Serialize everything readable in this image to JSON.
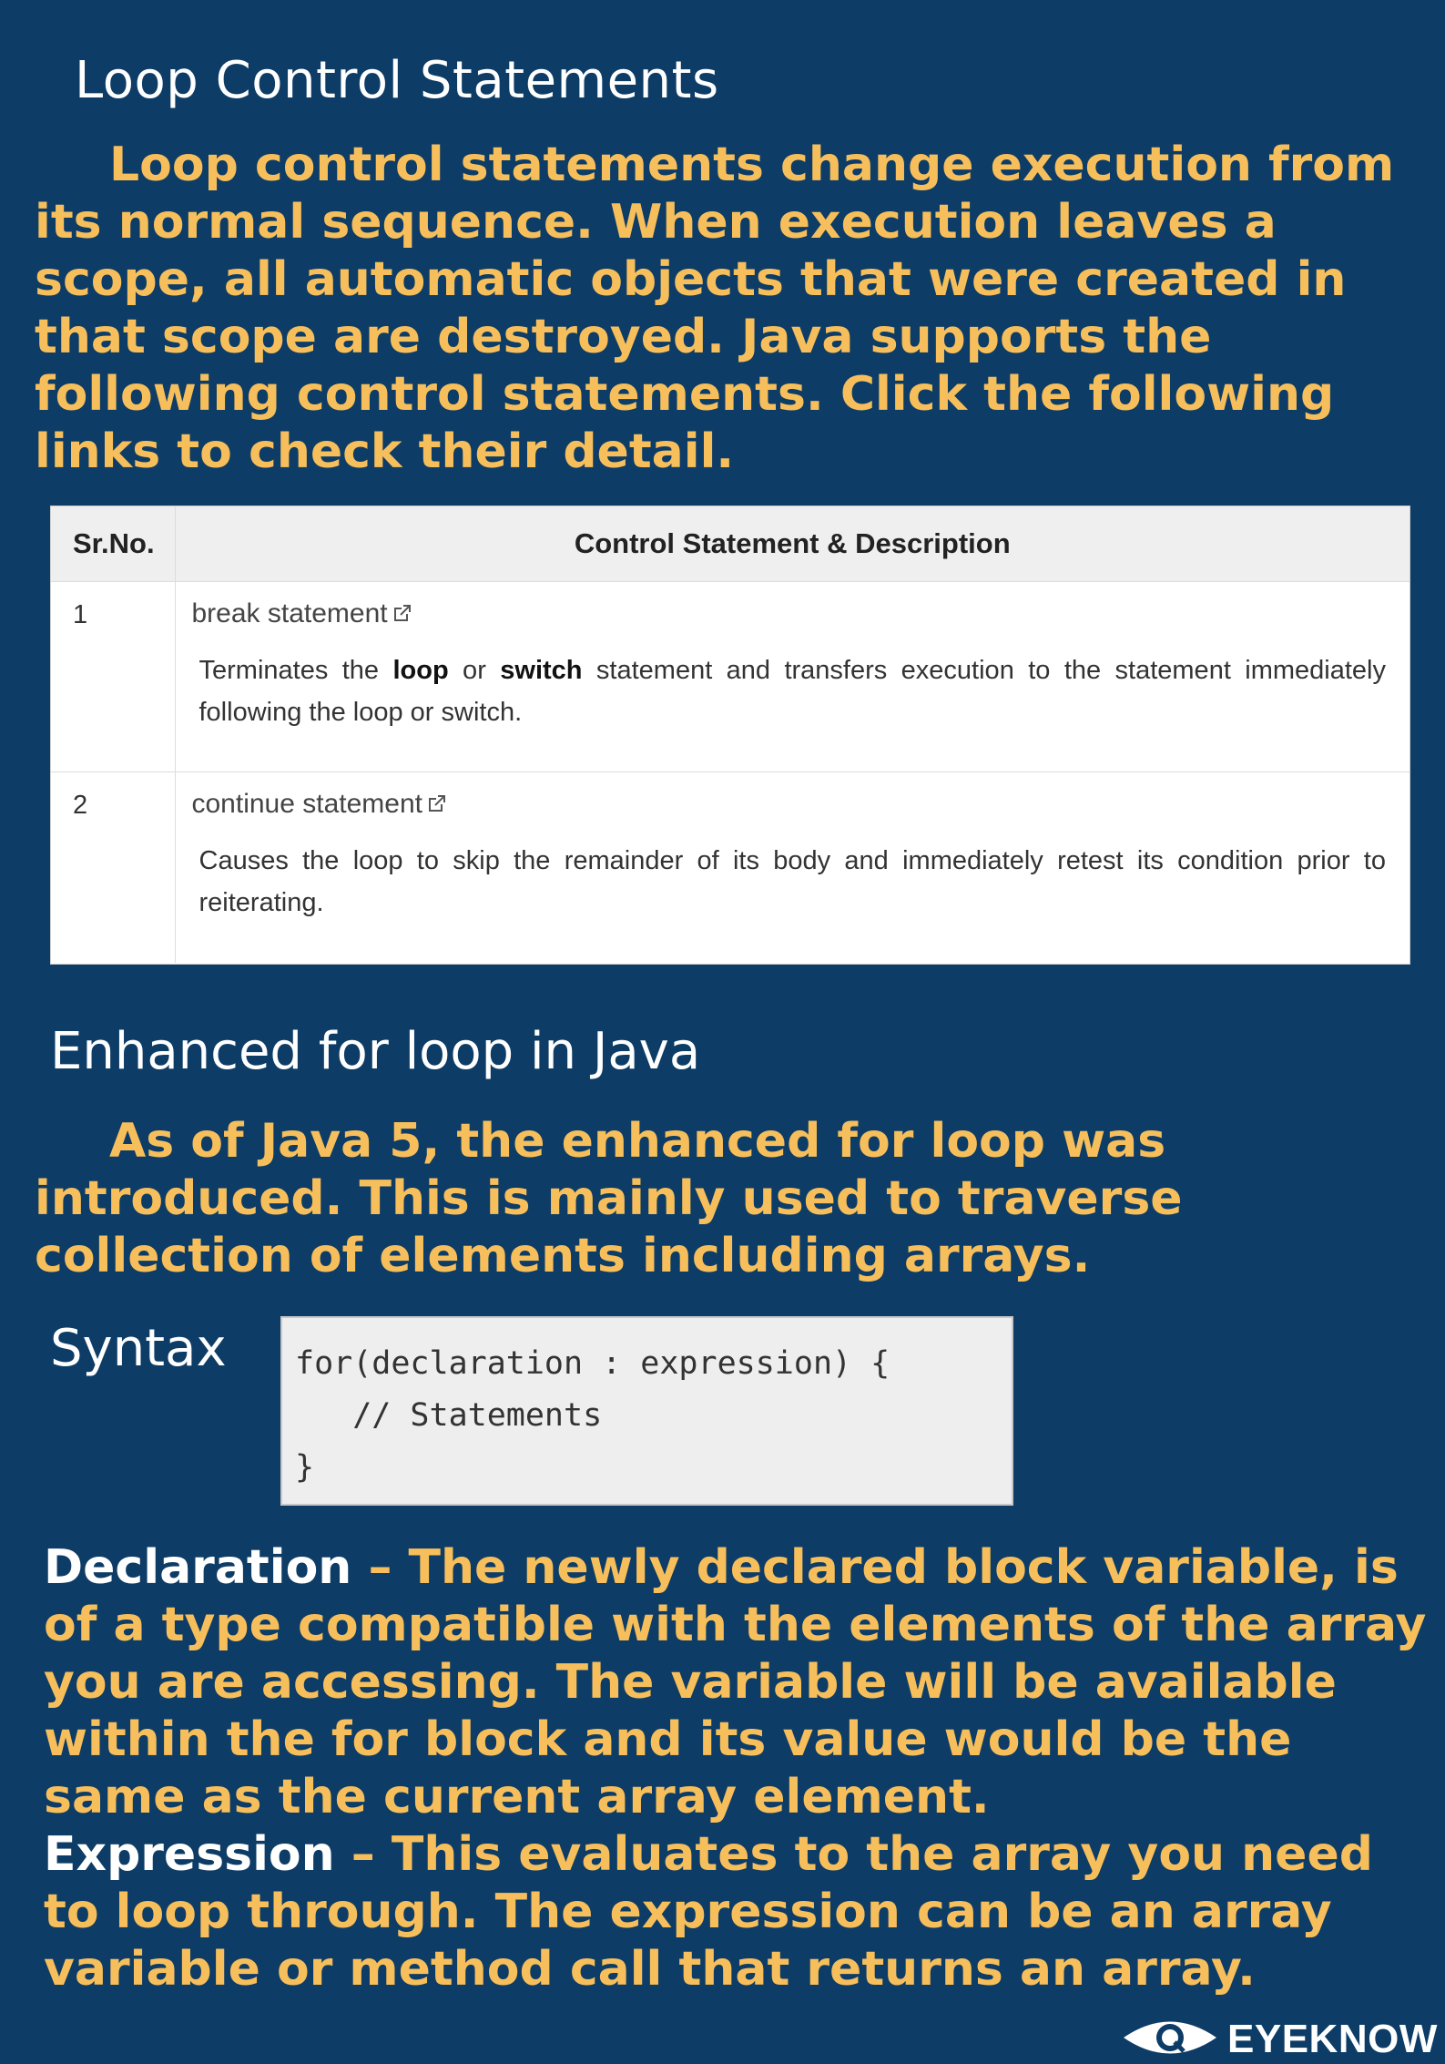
{
  "heading1": "Loop Control Statements",
  "intro": "Loop control statements change execution from its normal sequence. When execution leaves a scope, all automatic objects that were created in that scope are destroyed. Java supports the following control statements. Click the following links to check their detail.",
  "table": {
    "headers": [
      "Sr.No.",
      "Control Statement & Description"
    ],
    "rows": [
      {
        "num": "1",
        "link": "break statement",
        "desc_parts": [
          "Terminates the ",
          "loop",
          " or ",
          "switch",
          " statement and transfers execution to the statement immediately following the loop or switch."
        ]
      },
      {
        "num": "2",
        "link": "continue statement",
        "desc": "Causes the loop to skip the remainder of its body and immediately retest its condition prior to reiterating."
      }
    ]
  },
  "heading2": "Enhanced for loop in Java",
  "enhanced_intro": "As of Java 5, the enhanced for loop was introduced. This is mainly used to traverse collection of elements including arrays.",
  "syntax_label": "Syntax",
  "code": {
    "line1": "for(declaration : expression) {",
    "line2": "   // Statements",
    "line3": "}"
  },
  "definitions": [
    {
      "term": "Declaration",
      "text": " – The newly declared block variable, is of a type compatible with the elements of the array you are accessing. The variable will be available within the for block and its value would be the same as the current array element."
    },
    {
      "term": "Expression",
      "text": " – This evaluates to the array you need to loop through. The expression can be an array variable or method call that returns an array."
    }
  ],
  "brand": {
    "name": "EYEKNOW",
    "icon": "eye-icon"
  },
  "colors": {
    "background": "#0d3c66",
    "accent": "#f7bf5c",
    "heading": "#ffffff"
  }
}
